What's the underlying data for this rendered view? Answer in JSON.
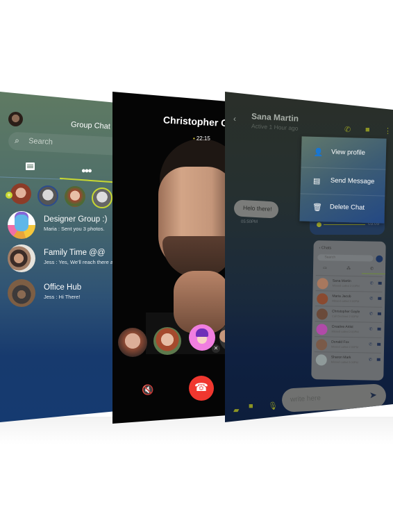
{
  "group_panel": {
    "title": "Group Chat",
    "search_placeholder": "Search",
    "icons": {
      "search": "search-icon",
      "chats_tab": "message-icon",
      "groups_tab": "group-icon",
      "add_story": "plus-icon"
    },
    "add_badge": "+",
    "chats": [
      {
        "name": "Designer Group :)",
        "last_message": "Maria : Sent you 3 photos."
      },
      {
        "name": "Family Time @@",
        "last_message": "Jess : Yes, We'll reach there at sh"
      },
      {
        "name": "Office Hub",
        "last_message": "Jess : Hi There!"
      }
    ],
    "colors": {
      "accent": "#c8d832",
      "bg_top": "#5f7a62",
      "bg_bottom": "#153a70"
    }
  },
  "call_panel": {
    "callee_name": "Christopher Ga",
    "timer": "22:15",
    "timer_dot": "•",
    "participants_muted_badge": "mic-off-icon",
    "speaker_icon": "🔇",
    "end_call_icon": "☎",
    "colors": {
      "end_call": "#f0372f",
      "bg": "#050505"
    }
  },
  "chat_panel": {
    "contact_name": "Sana Martin",
    "contact_status": "Active 1 Hour ago",
    "back_icon": "‹",
    "header_icons": {
      "call": "✆",
      "video": "■",
      "more": "⋮"
    },
    "context_menu": [
      {
        "icon": "👤",
        "label": "View profile"
      },
      {
        "icon": "▤",
        "label": "Send Message"
      },
      {
        "icon": "🗑",
        "label": "Delete Chat"
      }
    ],
    "audio_duration": "03:05",
    "incoming_message": "Helo there!",
    "incoming_time": "05:50PM",
    "input_placeholder": "write here",
    "send_icon": "➤",
    "bottom_icons": {
      "image": "▰",
      "video": "■",
      "mic": "🎙"
    },
    "shared_screenshot": {
      "header": "‹ Chats",
      "search_placeholder": "Search",
      "tabs": [
        "▭",
        "⁂",
        "✆"
      ],
      "contacts": [
        {
          "name": "Sana Martin",
          "sub": "Missed called 2:00PM"
        },
        {
          "name": "Maria Jacob",
          "sub": "Missed called 2:00PM"
        },
        {
          "name": "Christopher Gayle",
          "sub": "Call Declined 2:00PM"
        },
        {
          "name": "Creative Artist",
          "sub": "Missed called 2:00PM"
        },
        {
          "name": "Donald Fox",
          "sub": "Missed called 2:00PM"
        },
        {
          "name": "Sharon Mark",
          "sub": "Missed called 2:00PM"
        }
      ]
    },
    "colors": {
      "accent": "#8c9424",
      "menu_top": "#61786b",
      "menu_bottom": "#234884"
    }
  }
}
